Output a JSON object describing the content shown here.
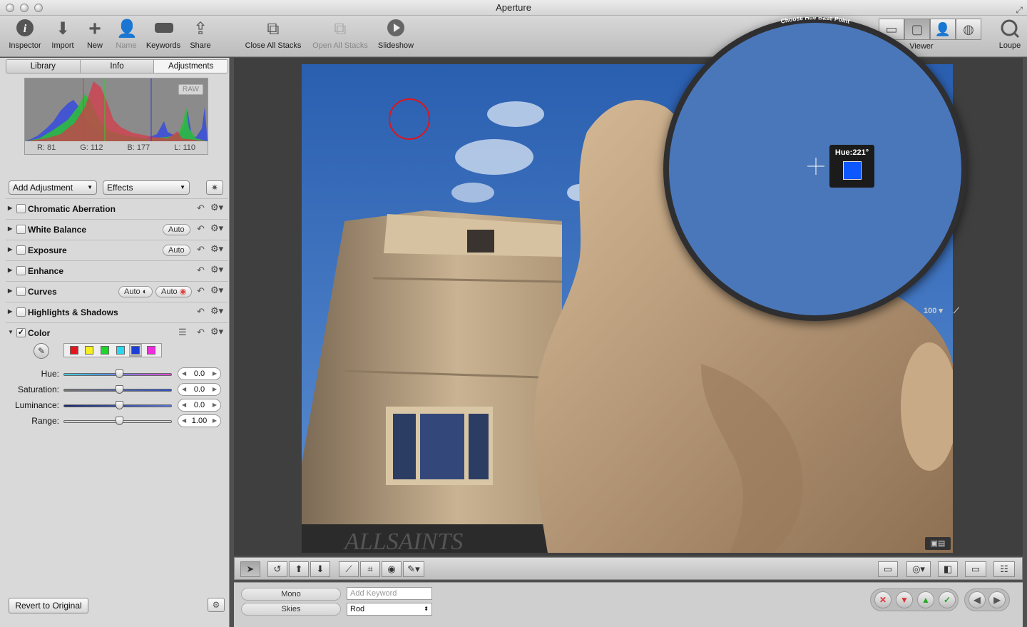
{
  "window": {
    "title": "Aperture"
  },
  "toolbar": {
    "inspector": "Inspector",
    "import": "Import",
    "new": "New",
    "name": "Name",
    "keywords": "Keywords",
    "share": "Share",
    "close_all_stacks": "Close All Stacks",
    "open_all_stacks": "Open All Stacks",
    "slideshow": "Slideshow",
    "viewer": "Viewer",
    "loupe": "Loupe"
  },
  "inspector": {
    "tabs": [
      "Library",
      "Info",
      "Adjustments"
    ],
    "active_tab": "Adjustments",
    "histogram": {
      "badge": "RAW",
      "r": "R: 81",
      "g": "G: 112",
      "b": "B: 177",
      "l": "L: 110"
    },
    "add_adjustment": "Add Adjustment",
    "effects": "Effects",
    "adjustments": [
      {
        "label": "Chromatic Aberration"
      },
      {
        "label": "White Balance",
        "auto": "Auto"
      },
      {
        "label": "Exposure",
        "auto": "Auto"
      },
      {
        "label": "Enhance"
      },
      {
        "label": "Curves",
        "auto": "Auto",
        "auto2": "Auto"
      },
      {
        "label": "Highlights & Shadows"
      },
      {
        "label": "Color",
        "checked": "✓"
      }
    ],
    "color": {
      "swatches": [
        "#e8141b",
        "#f6f01e",
        "#1ed52e",
        "#26d9f0",
        "#1b3fd6",
        "#ee2ddc"
      ],
      "selected": 4,
      "sliders": [
        {
          "label": "Hue:",
          "value": "0.0"
        },
        {
          "label": "Saturation:",
          "value": "0.0"
        },
        {
          "label": "Luminance:",
          "value": "0.0"
        },
        {
          "label": "Range:",
          "value": "1.00"
        }
      ]
    },
    "revert": "Revert to Original"
  },
  "viewer": {
    "loupe_caption": "Choose Hue Base Point",
    "hue_readout": "Hue:221°",
    "hue_color": "#0d57ff",
    "zoom": "100",
    "photo_sign": "ALLSAINTS"
  },
  "metadata": {
    "fields": [
      "Mono",
      "Skies"
    ],
    "keyword_placeholder": "Add Keyword",
    "keyword_select": "Rod"
  }
}
